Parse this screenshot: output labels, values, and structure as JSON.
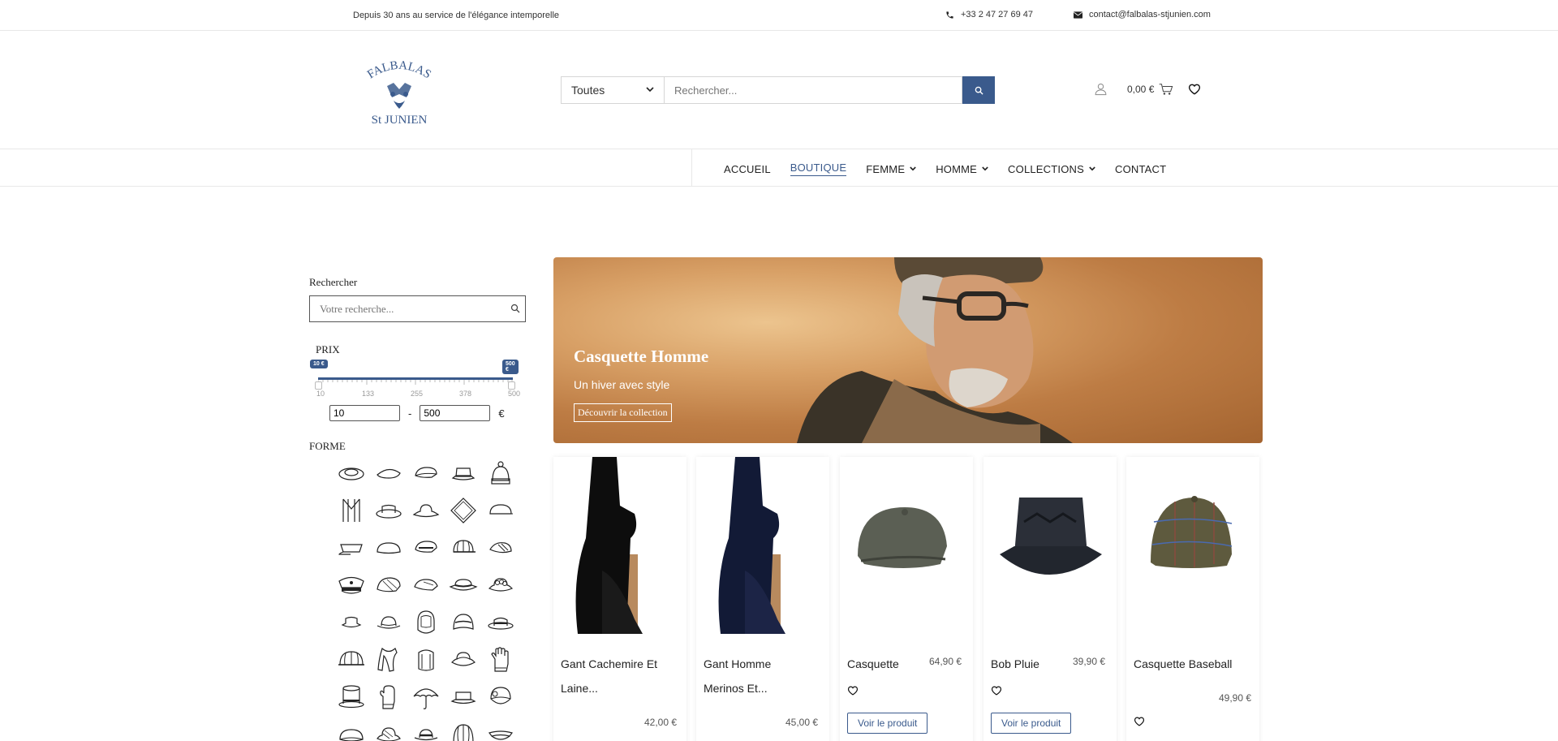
{
  "topbar": {
    "tagline": "Depuis 30 ans au service de l'élégance intemporelle",
    "phone": "+33 2 47 27 69 47",
    "email": "contact@falbalas-stjunien.com"
  },
  "logo": {
    "line1": "FALBALAS",
    "line2": "St JUNIEN"
  },
  "search": {
    "category": "Toutes",
    "placeholder": "Rechercher..."
  },
  "header": {
    "cart_total": "0,00 €"
  },
  "nav": {
    "items": [
      {
        "label": "ACCUEIL"
      },
      {
        "label": "BOUTIQUE"
      },
      {
        "label": "FEMME"
      },
      {
        "label": "HOMME"
      },
      {
        "label": "COLLECTIONS"
      },
      {
        "label": "CONTACT"
      }
    ]
  },
  "sidebar": {
    "search_title": "Rechercher",
    "search_placeholder": "Votre recherche...",
    "price_title": "PRIX",
    "price_min_tag": "10 €",
    "price_max_tag": "500 €",
    "tick_labels": [
      "10",
      "133",
      "255",
      "378",
      "500"
    ],
    "min_value": "10",
    "max_value": "500",
    "separator": "-",
    "currency": "€",
    "forme_title": "FORME"
  },
  "banner": {
    "title": "Casquette Homme",
    "subtitle": "Un hiver avec style",
    "cta": "Découvrir la collection"
  },
  "products": [
    {
      "name_line1": "Gant Cachemire Et",
      "name_line2": "Laine...",
      "price": "42,00 €"
    },
    {
      "name_line1": "Gant Homme",
      "name_line2": "Merinos Et...",
      "price": "45,00 €"
    },
    {
      "name_line1": "Casquette",
      "price": "64,90 €",
      "button": "Voir le produit"
    },
    {
      "name_line1": "Bob Pluie",
      "price": "39,90 €",
      "button": "Voir le produit"
    },
    {
      "name_line1": "Casquette Baseball",
      "price": "49,90 €"
    }
  ],
  "colors": {
    "accent": "#3a5a8c"
  }
}
